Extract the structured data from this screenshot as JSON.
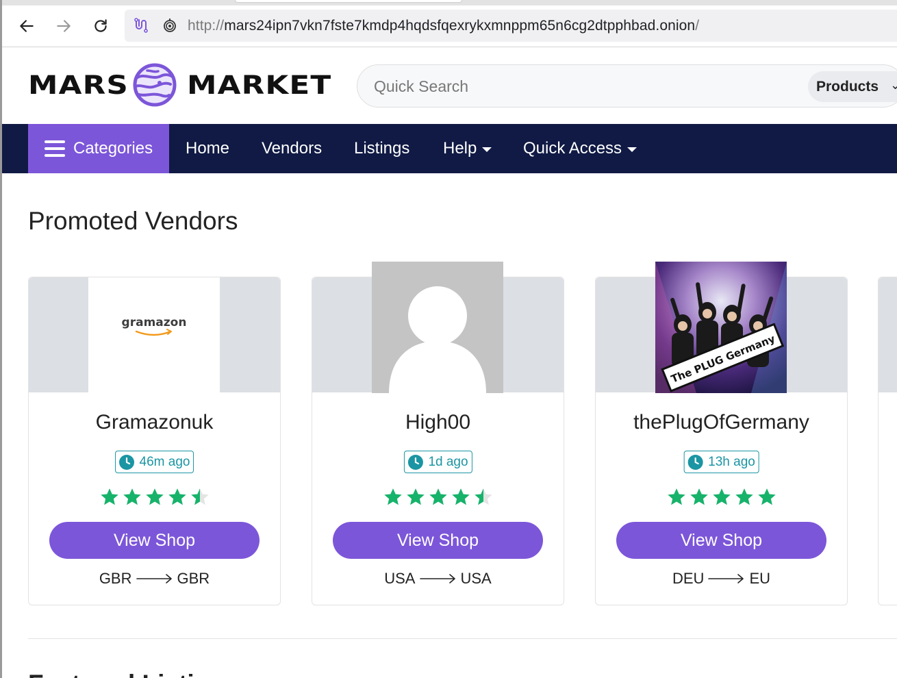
{
  "browser": {
    "url_scheme": "http://",
    "url_host": "mars24ipn7vkn7fste7kmdp4hqdsfqexrykxmnppm65n6cg2dtpphbad.onion",
    "url_path": "/"
  },
  "header": {
    "logo_left": "MARS",
    "logo_right": "MARKET",
    "search_placeholder": "Quick Search",
    "search_scope": "Products"
  },
  "nav": {
    "categories": "Categories",
    "home": "Home",
    "vendors": "Vendors",
    "listings": "Listings",
    "help": "Help",
    "quick_access": "Quick Access"
  },
  "promoted": {
    "title": "Promoted Vendors",
    "vendors": [
      {
        "name": "Gramazonuk",
        "last_seen": "46m ago",
        "rating": 4.5,
        "button": "View Shop",
        "from": "GBR",
        "to": "GBR",
        "logo_text": "gramazon"
      },
      {
        "name": "High00",
        "last_seen": "1d ago",
        "rating": 4.5,
        "button": "View Shop",
        "from": "USA",
        "to": "USA"
      },
      {
        "name": "thePlugOfGermany",
        "last_seen": "13h ago",
        "rating": 5,
        "button": "View Shop",
        "from": "DEU",
        "to": "EU",
        "logo_text": "The PLUG Germany"
      }
    ]
  },
  "colors": {
    "accent": "#7c56d9",
    "navbar": "#101a44",
    "star": "#17b36b",
    "badge": "#1b95a3"
  },
  "next_section": {
    "title": "Featured Listings"
  }
}
